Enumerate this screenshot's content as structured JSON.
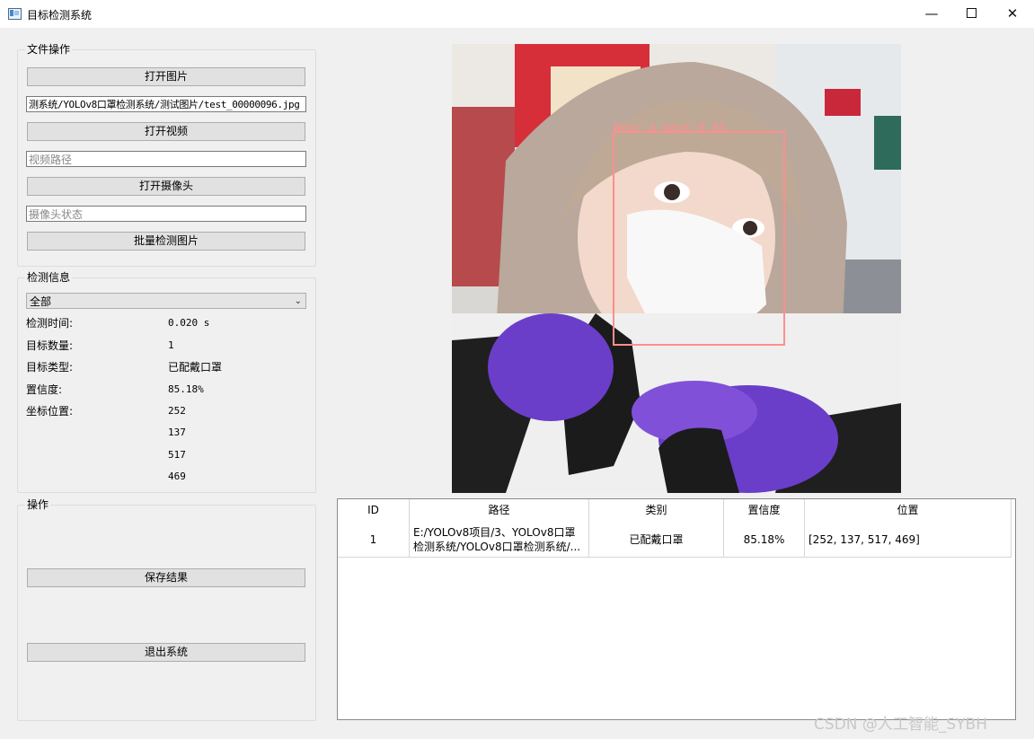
{
  "window": {
    "title": "目标检测系统"
  },
  "file_ops": {
    "group_title": "文件操作",
    "open_image": "打开图片",
    "image_path": "测系统/YOLOv8口罩检测系统/测试图片/test_00000096.jpg",
    "open_video": "打开视频",
    "video_placeholder": "视频路径",
    "open_camera": "打开摄像头",
    "camera_placeholder": "摄像头状态",
    "batch_detect": "批量检测图片"
  },
  "info": {
    "group_title": "检测信息",
    "target_select": "全部",
    "time_label": "检测时间:",
    "time_value": "0.020 s",
    "count_label": "目标数量:",
    "count_value": "1",
    "type_label": "目标类型:",
    "type_value": "已配戴口罩",
    "conf_label": "置信度:",
    "conf_value": "85.18%",
    "pos_label": "坐标位置:",
    "xmin": "252",
    "ymin": "137",
    "xmax": "517",
    "ymax": "469"
  },
  "ops": {
    "group_title": "操作",
    "save": "保存结果",
    "exit": "退出系统"
  },
  "detection": {
    "box_label": "Wear a mask 0.85",
    "box_color": "#ff8f8f"
  },
  "table": {
    "headers": [
      "ID",
      "路径",
      "类别",
      "置信度",
      "位置"
    ],
    "rows": [
      {
        "id": "1",
        "path": "E:/YOLOv8项目/3、YOLOv8口罩检测系统/YOLOv8口罩检测系统/...",
        "class": "已配戴口罩",
        "confidence": "85.18%",
        "position": "[252, 137, 517, 469]"
      }
    ]
  },
  "watermark": "CSDN @人工智能_SYBH"
}
